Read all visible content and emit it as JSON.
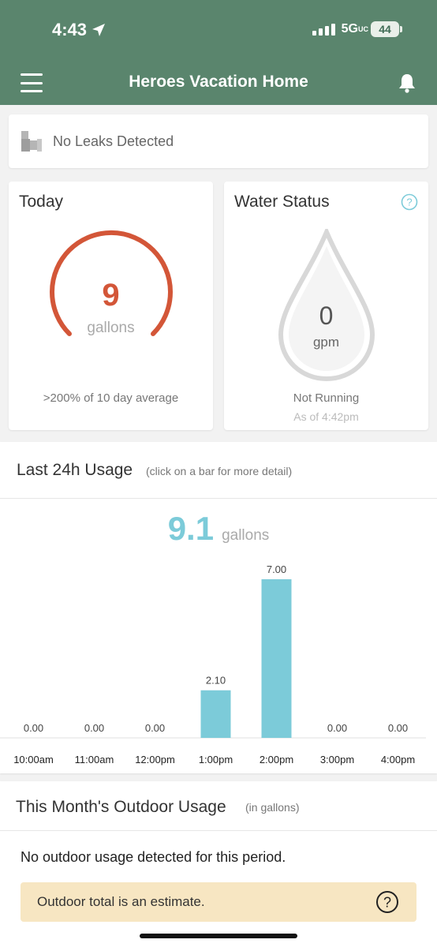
{
  "status_bar": {
    "time": "4:43",
    "network": "5G",
    "network_suffix": "UC",
    "battery": "44"
  },
  "header": {
    "title": "Heroes Vacation Home"
  },
  "leak": {
    "text": "No Leaks Detected"
  },
  "today": {
    "title": "Today",
    "value": "9",
    "unit": "gallons",
    "comparison": ">200% of 10 day average"
  },
  "water_status": {
    "title": "Water Status",
    "value": "0",
    "unit": "gpm",
    "state": "Not Running",
    "as_of": "As of 4:42pm"
  },
  "usage": {
    "title": "Last 24h Usage",
    "hint": "(click on a bar for more detail)",
    "total": "9.1",
    "total_unit": "gallons"
  },
  "chart_data": {
    "type": "bar",
    "categories": [
      "10:00am",
      "11:00am",
      "12:00pm",
      "1:00pm",
      "2:00pm",
      "3:00pm",
      "4:00pm"
    ],
    "values": [
      0.0,
      0.0,
      0.0,
      2.1,
      7.0,
      0.0,
      0.0
    ],
    "data_labels": [
      "0.00",
      "0.00",
      "0.00",
      "2.10",
      "7.00",
      "0.00",
      "0.00"
    ],
    "ylim": [
      0,
      7
    ],
    "grid": false,
    "bar_color": "#7ccbd9"
  },
  "outdoor": {
    "title": "This Month's Outdoor Usage",
    "hint": "(in gallons)",
    "empty": "No outdoor usage detected for this period.",
    "estimate": "Outdoor total is an estimate."
  },
  "colors": {
    "header": "#5a856d",
    "accent": "#7ccbd9",
    "gauge": "#d35638",
    "banner": "#f7e6c2"
  }
}
